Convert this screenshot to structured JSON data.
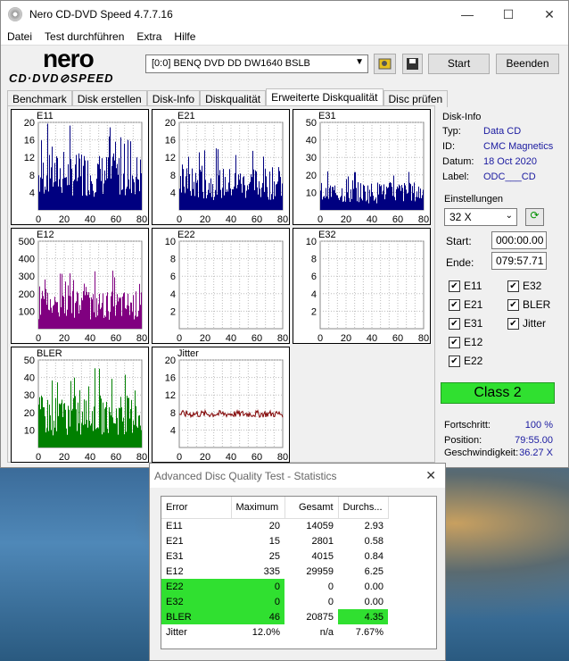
{
  "window": {
    "title": "Nero CD-DVD Speed 4.7.7.16",
    "min_glyph": "—",
    "max_glyph": "☐",
    "close_glyph": "✕"
  },
  "menu": [
    "Datei",
    "Test durchführen",
    "Extra",
    "Hilfe"
  ],
  "logo": {
    "top": "nero",
    "bottom": "CD·DVD⊘SPEED"
  },
  "drive": {
    "value": "[0:0]  BENQ DVD DD DW1640 BSLB"
  },
  "toolbar": {
    "start_label": "Start",
    "end_label": "Beenden"
  },
  "tabs": [
    "Benchmark",
    "Disk erstellen",
    "Disk-Info",
    "Diskqualität",
    "Erweiterte Diskqualität",
    "Disc prüfen"
  ],
  "active_tab": "Erweiterte Diskqualität",
  "disc_info": {
    "heading": "Disk-Info",
    "rows": [
      {
        "key": "Typ:",
        "value": "Data CD"
      },
      {
        "key": "ID:",
        "value": "CMC Magnetics"
      },
      {
        "key": "Datum:",
        "value": "18 Oct 2020"
      },
      {
        "key": "Label:",
        "value": "ODC___CD"
      }
    ]
  },
  "settings": {
    "heading": "Einstellungen",
    "speed": "32 X",
    "start_label": "Start:",
    "start_value": "000:00.00",
    "end_label": "Ende:",
    "end_value": "079:57.71",
    "checkboxes": [
      {
        "label": "E11",
        "checked": true
      },
      {
        "label": "E32",
        "checked": true
      },
      {
        "label": "E21",
        "checked": true
      },
      {
        "label": "BLER",
        "checked": true
      },
      {
        "label": "E31",
        "checked": true
      },
      {
        "label": "Jitter",
        "checked": true
      },
      {
        "label": "E12",
        "checked": true
      },
      {
        "label": "E22",
        "checked": true
      }
    ]
  },
  "class_label": "Class 2",
  "progress": {
    "fort_label": "Fortschritt:",
    "fort_value": "100 %",
    "pos_label": "Position:",
    "pos_value": "79:55.00",
    "speed_label": "Geschwindigkeit:",
    "speed_value": "36.27 X"
  },
  "stats": {
    "title": "Advanced Disc Quality Test - Statistics",
    "headers": [
      "Error",
      "Maximum",
      "Gesamt",
      "Durchs..."
    ],
    "rows": [
      {
        "error": "E11",
        "max": "20",
        "total": "14059",
        "avg": "2.93"
      },
      {
        "error": "E21",
        "max": "15",
        "total": "2801",
        "avg": "0.58"
      },
      {
        "error": "E31",
        "max": "25",
        "total": "4015",
        "avg": "0.84"
      },
      {
        "error": "E12",
        "max": "335",
        "total": "29959",
        "avg": "6.25"
      },
      {
        "error": "E22",
        "max": "0",
        "total": "0",
        "avg": "0.00"
      },
      {
        "error": "E32",
        "max": "0",
        "total": "0",
        "avg": "0.00"
      },
      {
        "error": "BLER",
        "max": "46",
        "total": "20875",
        "avg": "4.35"
      },
      {
        "error": "Jitter",
        "max": "12.0%",
        "total": "n/a",
        "avg": "7.67%"
      }
    ],
    "highlight_color": "#30e030"
  },
  "chart_data": [
    {
      "type": "bar",
      "title": "E11",
      "color": "#000080",
      "ylim": [
        0,
        20
      ],
      "yticks": [
        4,
        8,
        12,
        16,
        20
      ],
      "xticks": [
        0,
        20,
        40,
        60,
        80
      ],
      "xlim": [
        0,
        80
      ],
      "peak": 20
    },
    {
      "type": "bar",
      "title": "E21",
      "color": "#000080",
      "ylim": [
        0,
        20
      ],
      "yticks": [
        4,
        8,
        12,
        16,
        20
      ],
      "xticks": [
        0,
        20,
        40,
        60,
        80
      ],
      "xlim": [
        0,
        80
      ],
      "peak": 15
    },
    {
      "type": "bar",
      "title": "E31",
      "color": "#000080",
      "ylim": [
        0,
        50
      ],
      "yticks": [
        10,
        20,
        30,
        40,
        50
      ],
      "xticks": [
        0,
        20,
        40,
        60,
        80
      ],
      "xlim": [
        0,
        80
      ],
      "peak": 25
    },
    {
      "type": "bar",
      "title": "E12",
      "color": "#800080",
      "ylim": [
        0,
        500
      ],
      "yticks": [
        100,
        200,
        300,
        400,
        500
      ],
      "xticks": [
        0,
        20,
        40,
        60,
        80
      ],
      "xlim": [
        0,
        80
      ],
      "peak": 335
    },
    {
      "type": "bar",
      "title": "E22",
      "color": "#000080",
      "ylim": [
        0,
        10
      ],
      "yticks": [
        2,
        4,
        6,
        8,
        10
      ],
      "xticks": [
        0,
        20,
        40,
        60,
        80
      ],
      "xlim": [
        0,
        80
      ],
      "peak": 0
    },
    {
      "type": "bar",
      "title": "E32",
      "color": "#000080",
      "ylim": [
        0,
        10
      ],
      "yticks": [
        2,
        4,
        6,
        8,
        10
      ],
      "xticks": [
        0,
        20,
        40,
        60,
        80
      ],
      "xlim": [
        0,
        80
      ],
      "peak": 0
    },
    {
      "type": "bar",
      "title": "BLER",
      "color": "#008000",
      "ylim": [
        0,
        50
      ],
      "yticks": [
        10,
        20,
        30,
        40,
        50
      ],
      "xticks": [
        0,
        20,
        40,
        60,
        80
      ],
      "xlim": [
        0,
        80
      ],
      "peak": 46
    },
    {
      "type": "line",
      "title": "Jitter",
      "color": "#800000",
      "ylim": [
        0,
        20
      ],
      "yticks": [
        4,
        8,
        12,
        16,
        20
      ],
      "xticks": [
        0,
        20,
        40,
        60,
        80
      ],
      "xlim": [
        0,
        80
      ],
      "level": 7.67
    }
  ]
}
